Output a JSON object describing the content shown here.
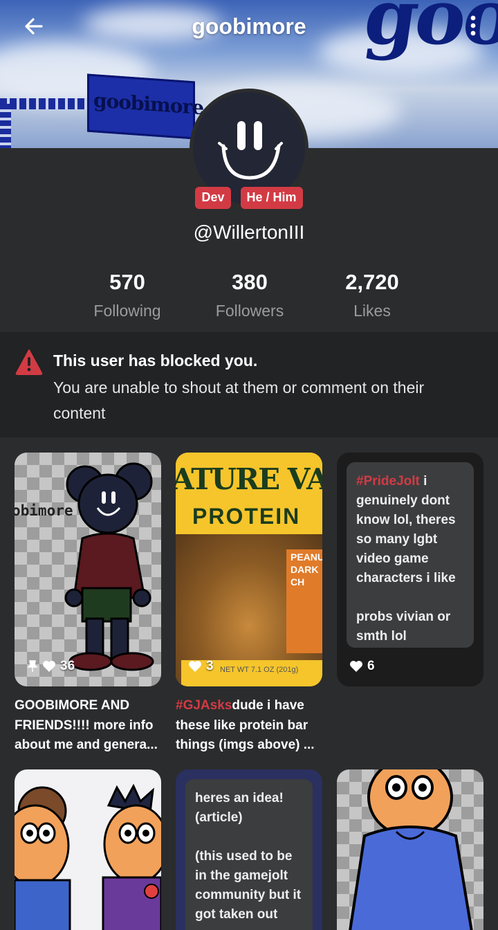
{
  "header": {
    "title": "goobimore",
    "banner_big_text": "goo",
    "banner_sign_text": "goobimore"
  },
  "profile": {
    "tags": [
      "Dev",
      "He / Him"
    ],
    "username": "@WillertonIII",
    "stats": [
      {
        "value": "570",
        "label": "Following"
      },
      {
        "value": "380",
        "label": "Followers"
      },
      {
        "value": "2,720",
        "label": "Likes"
      }
    ]
  },
  "notice": {
    "title": "This user has blocked you.",
    "text": "You are unable to shout at them or comment on their content"
  },
  "posts": [
    {
      "likes": "36",
      "pinned": true,
      "caption": "GOOBIMORE AND FRIENDS!!!! more info about me and genera...",
      "thumb_text": "obimore"
    },
    {
      "likes": "3",
      "caption_tag": "#GJAsks",
      "caption": "dude i have these like   protein bar things (imgs above) ...",
      "thumb_title": "ATURE VALL",
      "thumb_sub": "PROTEIN",
      "thumb_side": [
        "PEANUT",
        "DARK CH"
      ],
      "thumb_weight": "NET WT 7.1 OZ (201g)"
    },
    {
      "likes": "6",
      "text_tag": "#PrideJolt",
      "text": " i genuinely dont know lol, theres so many lgbt video game characters i like",
      "text_faded": "probs vivian or smth lol"
    },
    {
      "caption": ""
    },
    {
      "text": "heres an idea! (article)",
      "text2": "(this used to be in the gamejolt community but it got taken out"
    },
    {
      "caption": ""
    }
  ],
  "colors": {
    "accent": "#d23b44",
    "background": "#2b2c2d",
    "notice_bg": "#222324"
  }
}
